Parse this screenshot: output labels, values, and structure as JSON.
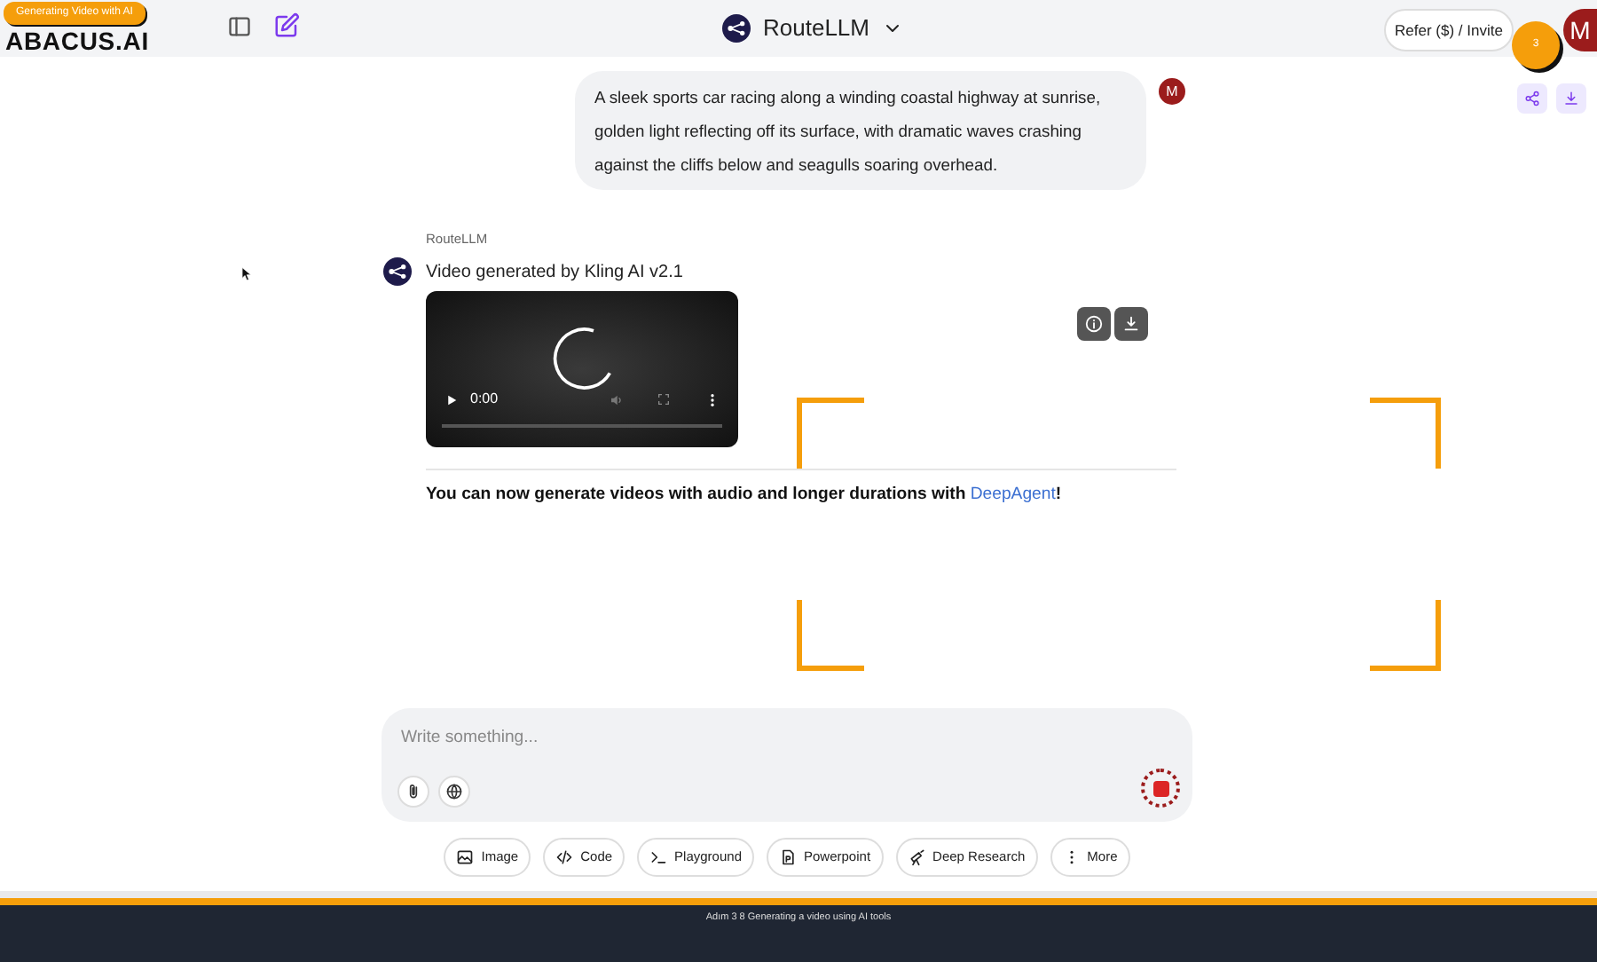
{
  "recording_badge": "Generating Video with AI",
  "header": {
    "logo": "ABACUS.AI",
    "model": "RouteLLM",
    "refer_button": "Refer ($) / Invite",
    "avatar": "M"
  },
  "click_marker": "3",
  "user_message": {
    "text": "A sleek sports car racing along a winding coastal highway at sunrise, golden light reflecting off its surface, with dramatic waves crashing against the cliffs below and seagulls soaring overhead.",
    "avatar": "M"
  },
  "bot_message": {
    "sender": "RouteLLM",
    "caption": "Video generated by Kling AI v2.1",
    "video_time": "0:00",
    "note": {
      "before": "You can now generate videos with audio and longer durations with ",
      "link": "DeepAgent",
      "after": "!"
    }
  },
  "composer": {
    "placeholder": "Write something..."
  },
  "tools": [
    {
      "label": "Image"
    },
    {
      "label": "Code"
    },
    {
      "label": "Playground"
    },
    {
      "label": "Powerpoint"
    },
    {
      "label": "Deep Research"
    },
    {
      "label": "More"
    }
  ],
  "footer": "Adım 3 8 Generating a video using AI tools"
}
